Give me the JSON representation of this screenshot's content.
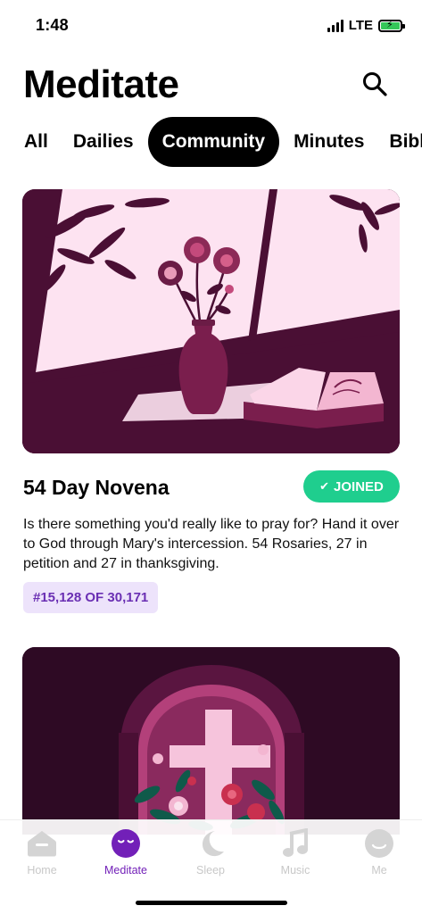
{
  "status": {
    "time": "1:48",
    "network": "LTE"
  },
  "header": {
    "title": "Meditate"
  },
  "tabs": [
    {
      "label": "All"
    },
    {
      "label": "Dailies"
    },
    {
      "label": "Community",
      "active": true
    },
    {
      "label": "Minutes"
    },
    {
      "label": "Bible"
    }
  ],
  "cards": [
    {
      "title": "54 Day Novena",
      "joined_label": "JOINED",
      "description": "Is there something you'd really like to pray for? Hand it over to God through Mary's intercession. 54 Rosaries, 27 in petition and 27 in thanksgiving.",
      "rank": "#15,128 OF 30,171",
      "image": "roses-vase-bible-illustration"
    },
    {
      "image": "cross-roses-arch-illustration"
    }
  ],
  "tab_bar": {
    "items": [
      {
        "label": "Home",
        "icon": "home-icon"
      },
      {
        "label": "Meditate",
        "icon": "meditate-icon",
        "active": true
      },
      {
        "label": "Sleep",
        "icon": "moon-icon"
      },
      {
        "label": "Music",
        "icon": "music-note-icon"
      },
      {
        "label": "Me",
        "icon": "profile-icon"
      }
    ]
  },
  "colors": {
    "accent": "#7220b8",
    "joined": "#1fce8e",
    "badge_bg": "#ede3fb",
    "badge_text": "#6a2fb3",
    "illustration_dark": "#4a0f34",
    "illustration_light": "#fde3f1"
  }
}
